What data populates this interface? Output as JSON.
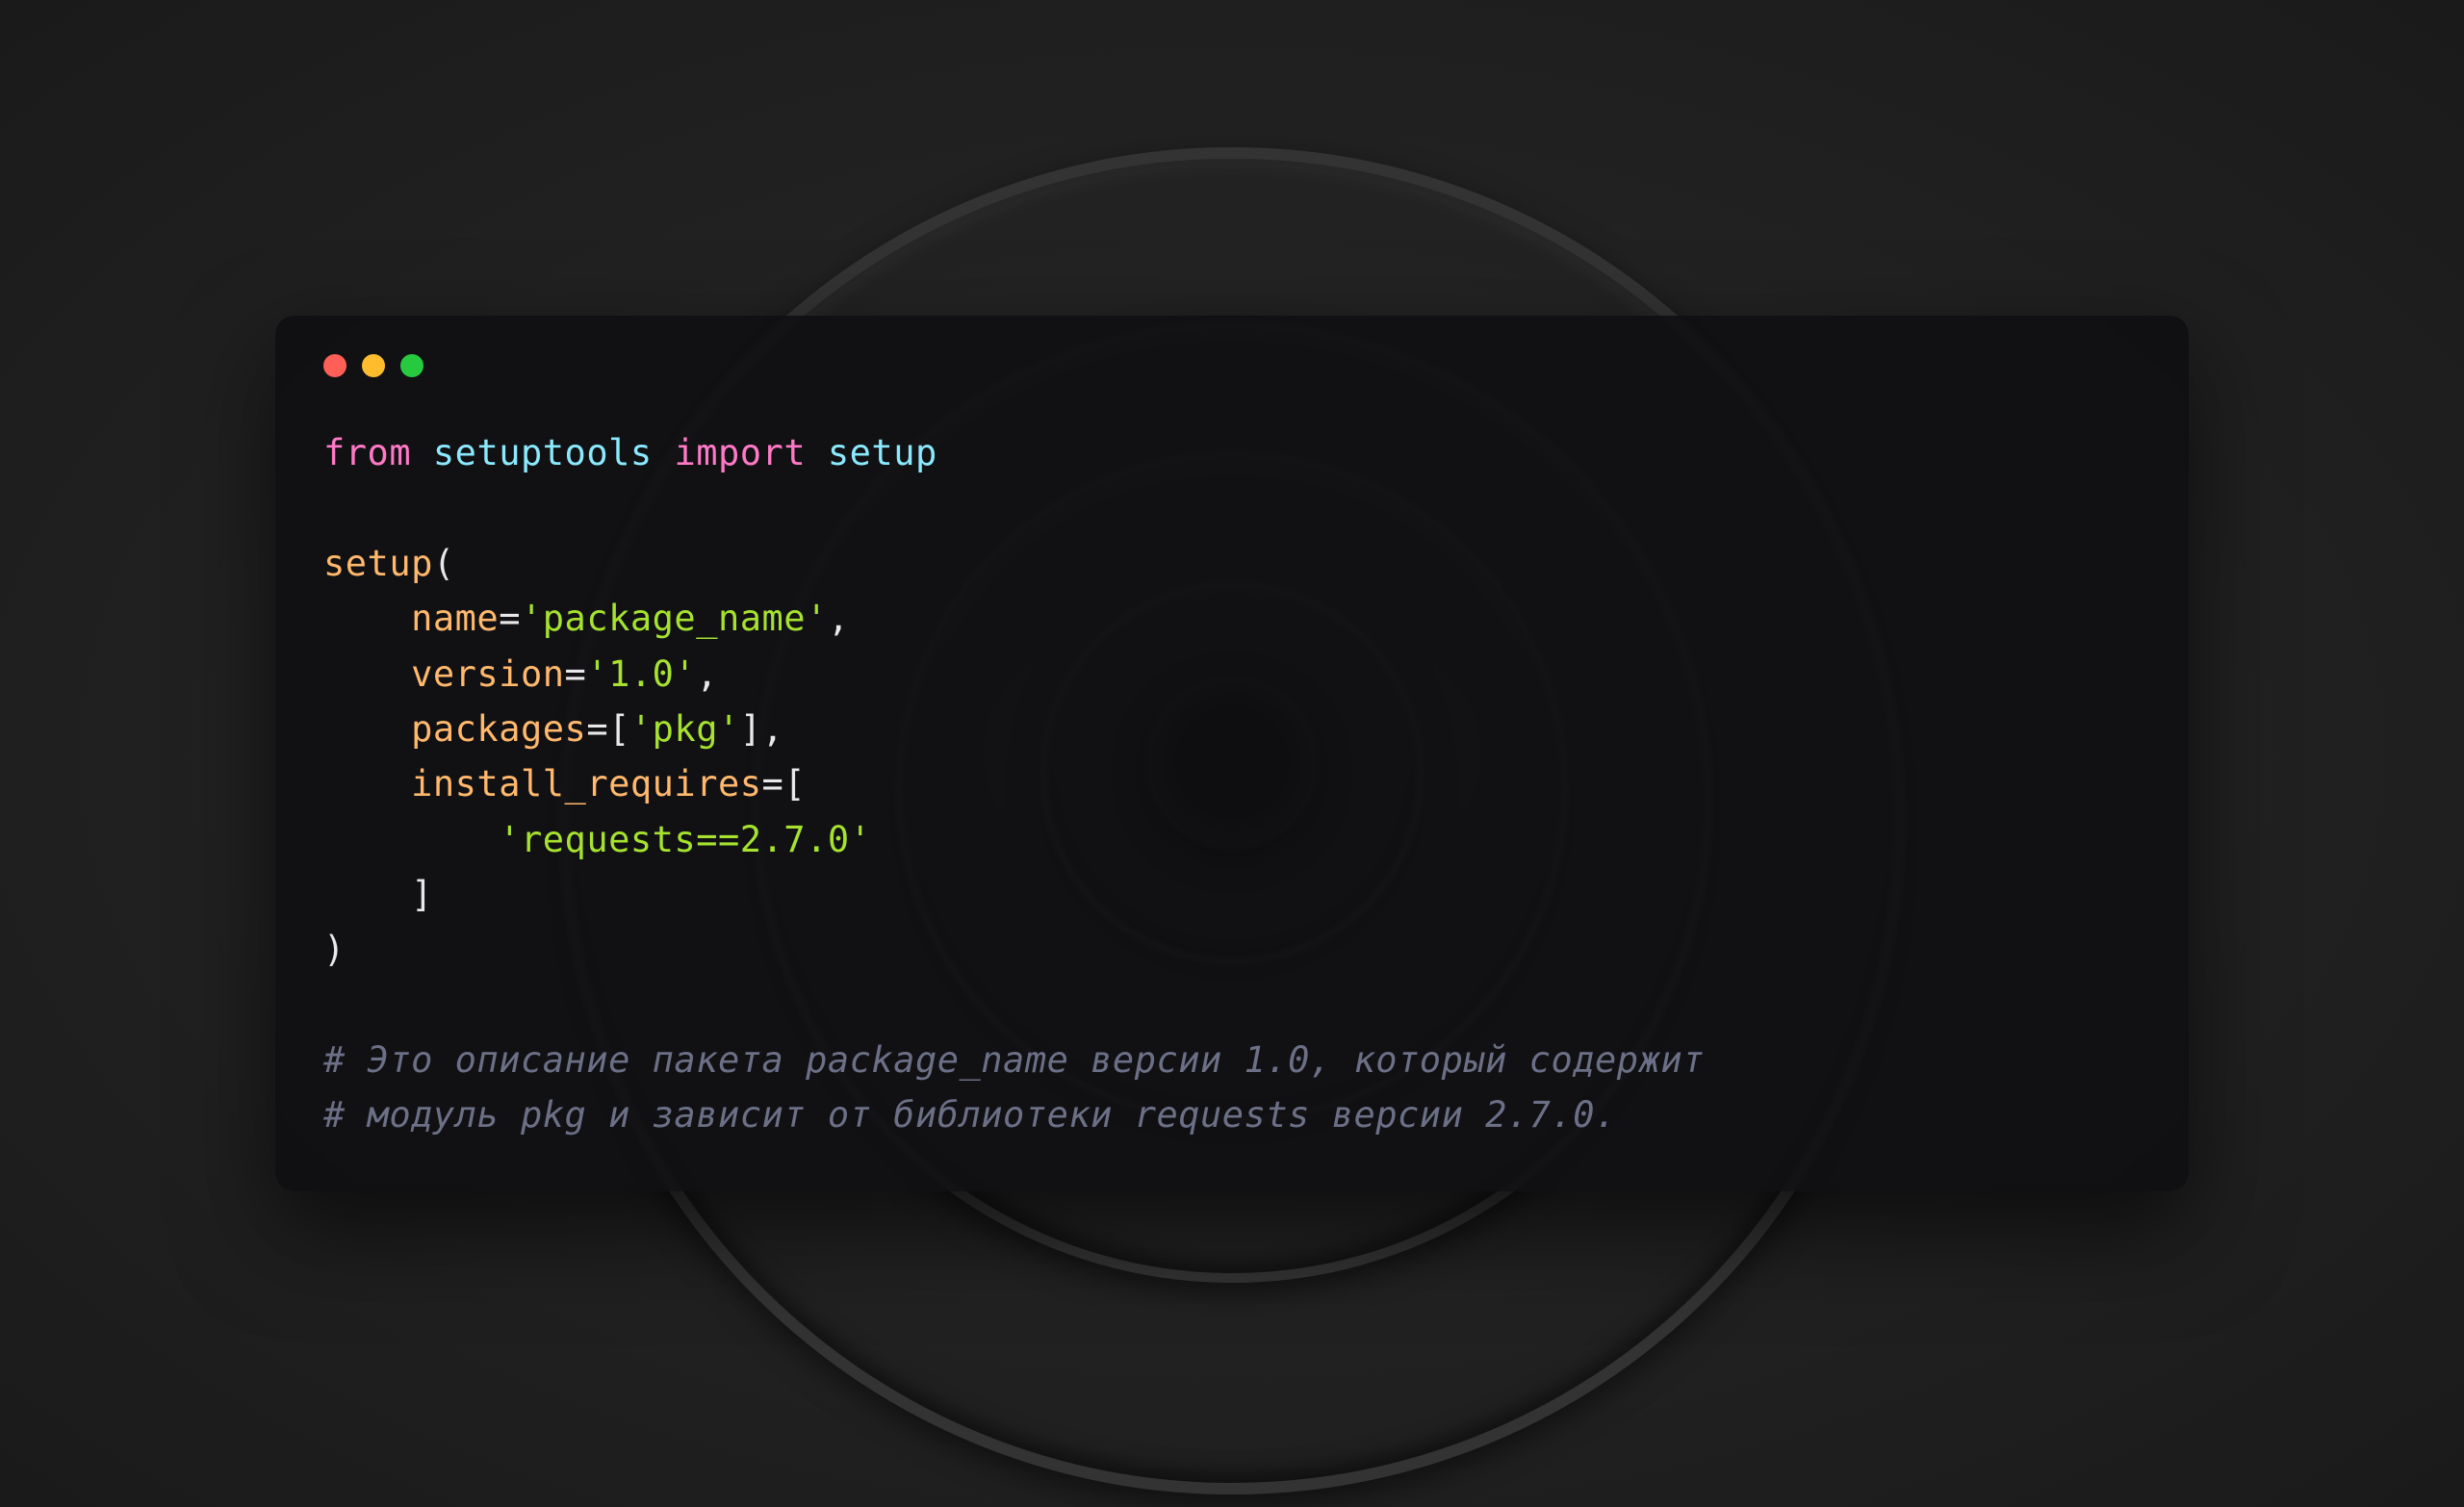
{
  "window": {
    "controls": {
      "close": "close",
      "minimize": "minimize",
      "maximize": "maximize"
    }
  },
  "code": {
    "line1": {
      "from": "from",
      "module": "setuptools",
      "import": "import",
      "name": "setup"
    },
    "line3": {
      "call": "setup",
      "open": "("
    },
    "line4": {
      "param": "name",
      "eq": "=",
      "value": "'package_name'",
      "comma": ","
    },
    "line5": {
      "param": "version",
      "eq": "=",
      "value": "'1.0'",
      "comma": ","
    },
    "line6": {
      "param": "packages",
      "eq": "=",
      "open": "[",
      "value": "'pkg'",
      "close": "]",
      "comma": ","
    },
    "line7": {
      "param": "install_requires",
      "eq": "=",
      "open": "["
    },
    "line8": {
      "value": "'requests==2.7.0'"
    },
    "line9": {
      "close": "]"
    },
    "line10": {
      "close": ")"
    },
    "comment1": "# Это описание пакета package_name версии 1.0, который содержит",
    "comment2": "# модуль pkg и зависит от библиотеки requests версии 2.7.0."
  }
}
